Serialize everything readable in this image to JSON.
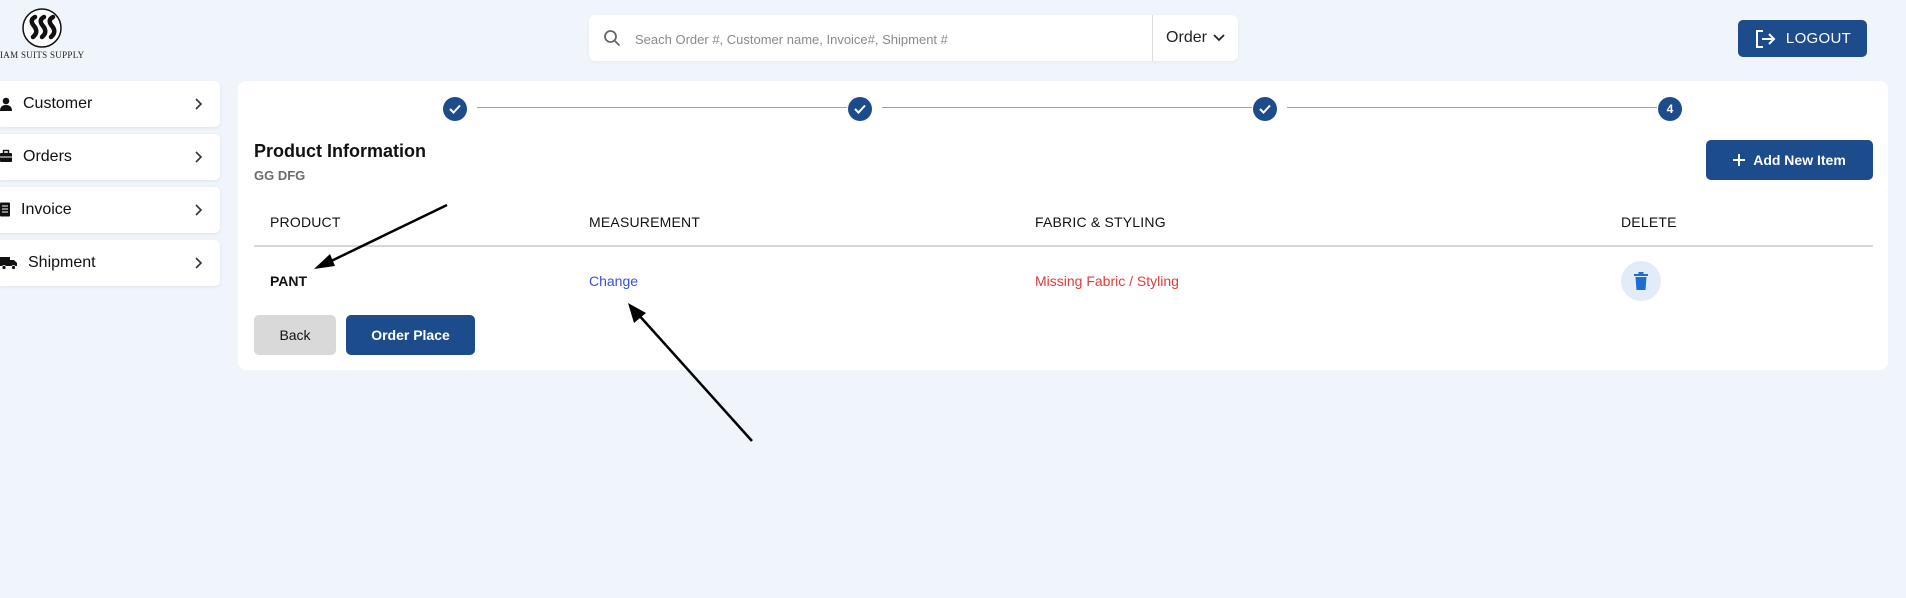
{
  "brand": {
    "logo_text": "IAM SUITS SUPPLY",
    "icon": "sss-logo-icon"
  },
  "search": {
    "placeholder": "Seach Order #, Customer name, Invoice#, Shipment #",
    "value": "",
    "type_label": "Order",
    "icon": "search-icon"
  },
  "logout": {
    "label": "LOGOUT",
    "icon": "logout-icon"
  },
  "sidebar": {
    "items": [
      {
        "label": "Customer",
        "icon": "person-icon"
      },
      {
        "label": "Orders",
        "icon": "briefcase-icon"
      },
      {
        "label": "Invoice",
        "icon": "document-icon"
      },
      {
        "label": "Shipment",
        "icon": "truck-icon"
      }
    ]
  },
  "stepper": {
    "steps": [
      {
        "state": "complete",
        "label": ""
      },
      {
        "state": "complete",
        "label": ""
      },
      {
        "state": "complete",
        "label": ""
      },
      {
        "state": "current",
        "label": "4"
      }
    ]
  },
  "product_info": {
    "title": "Product Information",
    "subtitle": "GG DFG",
    "add_button": "Add New Item"
  },
  "table": {
    "headers": [
      "PRODUCT",
      "MEASUREMENT",
      "FABRIC & STYLING",
      "DELETE"
    ],
    "rows": [
      {
        "product": "PANT",
        "measurement": "Change",
        "fabric": "Missing Fabric / Styling"
      }
    ]
  },
  "actions": {
    "back": "Back",
    "place": "Order Place"
  },
  "colors": {
    "primary": "#1c4c8c",
    "background": "#f0f4fb",
    "link": "#3a4fe0",
    "error": "#e03a3a",
    "delete_bg": "#e2ecf9"
  }
}
